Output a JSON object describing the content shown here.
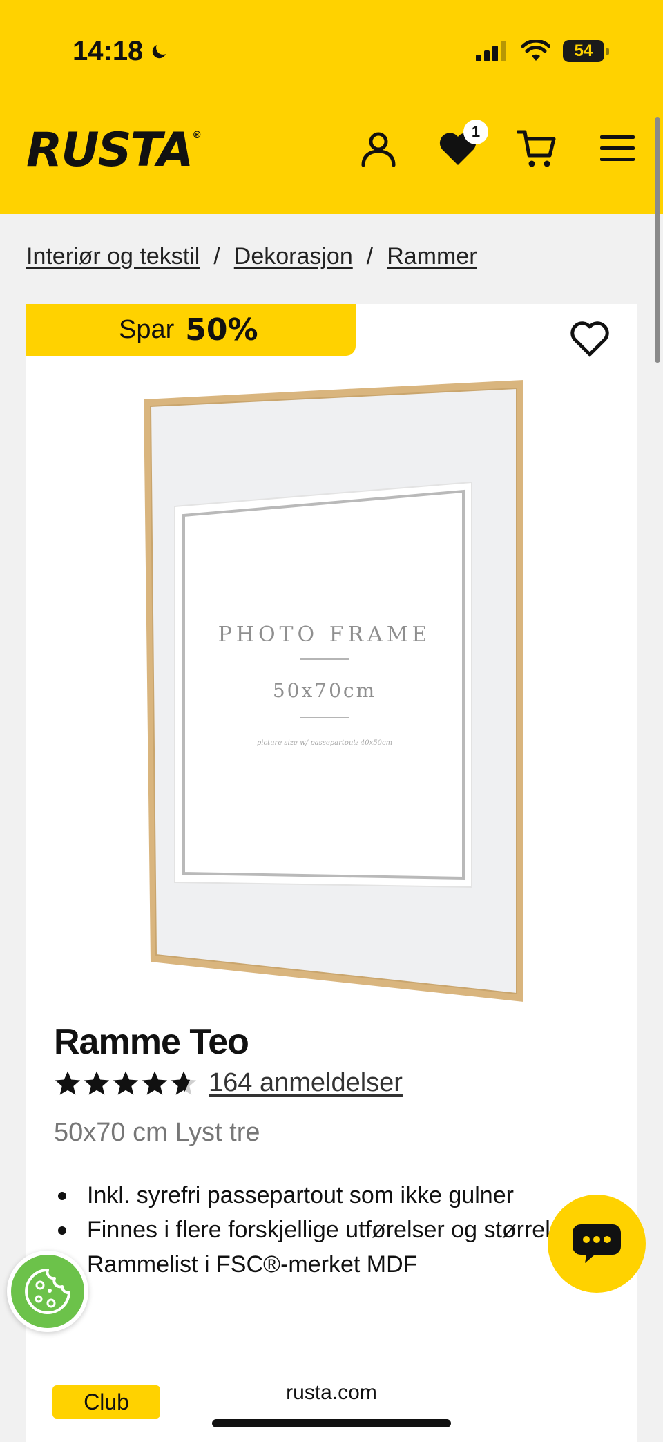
{
  "status_bar": {
    "time": "14:18",
    "battery": "54"
  },
  "header": {
    "logo": "RUSTA",
    "wishlist_count": "1"
  },
  "breadcrumb": [
    {
      "label": "Interiør og tekstil"
    },
    {
      "label": "Dekorasjon"
    },
    {
      "label": "Rammer"
    }
  ],
  "product": {
    "save_label": "Spar",
    "save_percent": "50%",
    "image_text": {
      "line1": "PHOTO FRAME",
      "line2": "50x70cm",
      "line3": "picture size w/ passepartout: 40x50cm"
    },
    "title": "Ramme Teo",
    "rating": 4.5,
    "reviews": "164 anmeldelser",
    "variant": "50x70 cm Lyst tre",
    "bullets": [
      "Inkl. syrefri passepartout som ikke gulner",
      "Finnes i flere forskjellige utførelser og størrelser",
      "Rammelist i FSC®-merket MDF"
    ],
    "club_label": "Club"
  },
  "browser": {
    "url": "rusta.com"
  },
  "colors": {
    "brand_yellow": "#ffd200",
    "cookie_green": "#6cc24a"
  }
}
